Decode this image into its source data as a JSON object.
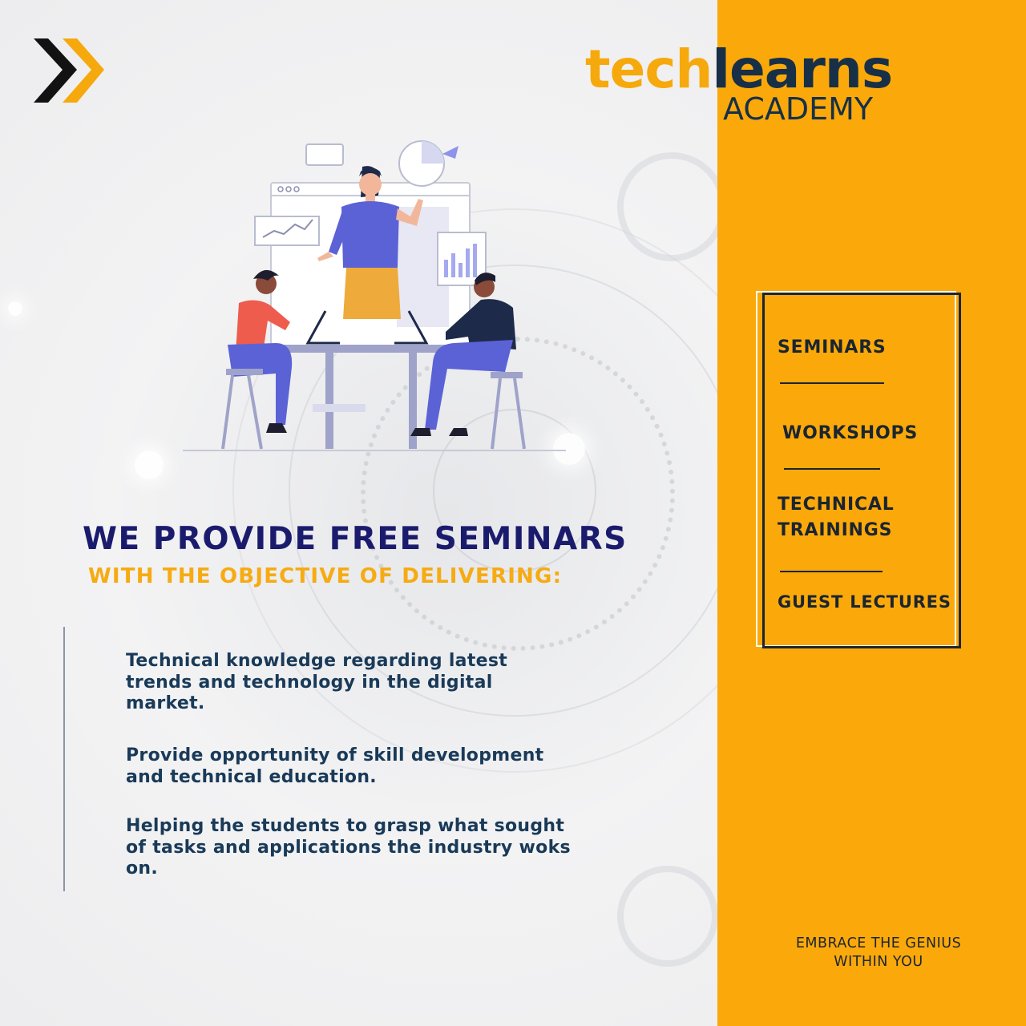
{
  "brand": {
    "logo_part_1": "tech",
    "logo_part_2": "learns",
    "logo_subtitle": "ACADEMY",
    "colors": {
      "orange": "#fba90a",
      "navy": "#1b1b6e",
      "dark": "#173047"
    }
  },
  "icons": {
    "top_left": "double-chevron-right-icon",
    "illustration": "team-meeting-illustration"
  },
  "headline": "WE PROVIDE FREE SEMINARS",
  "subheadline": "WITH THE OBJECTIVE OF DELIVERING:",
  "objectives": [
    "Technical knowledge regarding latest trends and technology in the digital market.",
    "Provide opportunity of skill development and technical education.",
    "Helping the students to grasp what sought of tasks and applications the industry woks on."
  ],
  "menu": [
    "SEMINARS",
    "WORKSHOPS",
    "TECHNICAL\nTRAININGS",
    "GUEST LECTURES"
  ],
  "tagline": "EMBRACE THE GENIUS\nWITHIN YOU"
}
